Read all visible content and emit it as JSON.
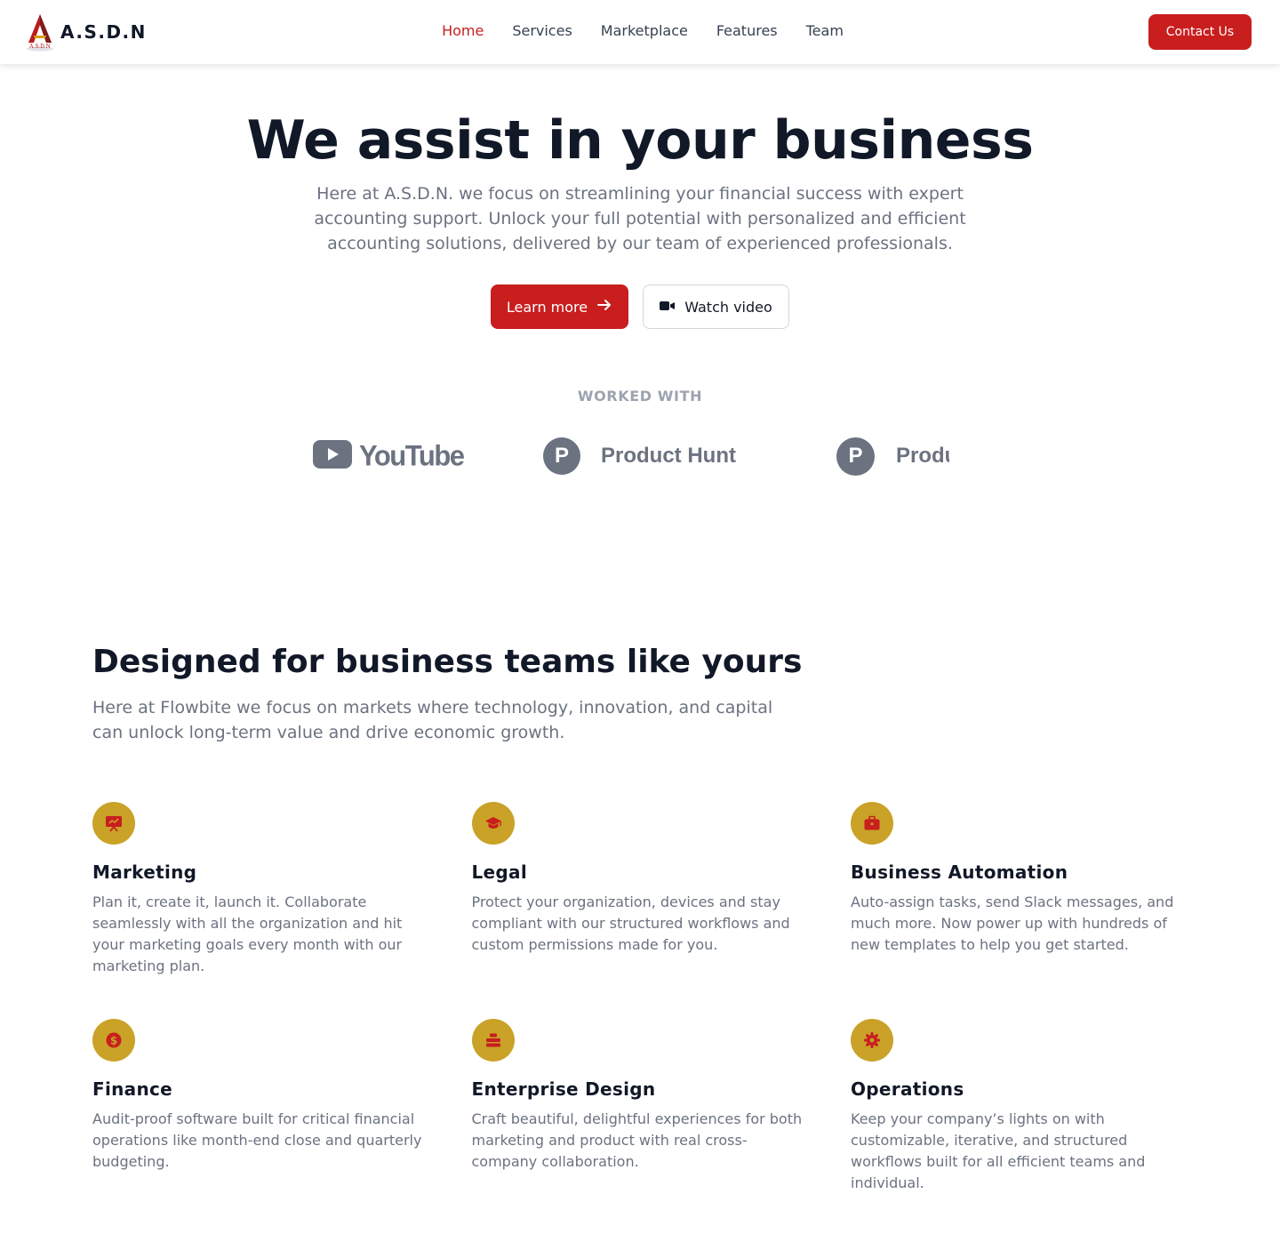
{
  "brand": {
    "name": "A.S.D.N",
    "logo_text": "A.S.D.N"
  },
  "nav": {
    "links": [
      {
        "label": "Home",
        "active": true
      },
      {
        "label": "Services",
        "active": false
      },
      {
        "label": "Marketplace",
        "active": false
      },
      {
        "label": "Features",
        "active": false
      },
      {
        "label": "Team",
        "active": false
      }
    ],
    "cta_label": "Contact Us"
  },
  "hero": {
    "title": "We assist in your business",
    "subtitle": "Here at A.S.D.N. we focus on streamlining your financial success with expert accounting support. Unlock your full potential with personalized and efficient accounting solutions, delivered by our team of experienced professionals.",
    "primary_label": "Learn more",
    "secondary_label": "Watch video"
  },
  "worked_with": {
    "label": "WORKED WITH",
    "logos": [
      {
        "name": "YouTube",
        "text": "YouTube",
        "icon": "youtube-play-icon"
      },
      {
        "name": "Product Hunt",
        "text": "Product Hunt",
        "icon": "product-hunt-icon",
        "letter": "P"
      },
      {
        "name": "Product Hunt",
        "text": "Product Hunt",
        "icon": "product-hunt-icon",
        "letter": "P"
      }
    ]
  },
  "features_section": {
    "title": "Designed for business teams like yours",
    "subtitle": "Here at Flowbite we focus on markets where technology, innovation, and capital can unlock long-term value and drive economic growth.",
    "items": [
      {
        "title": "Marketing",
        "icon": "presentation-chart-icon",
        "description": "Plan it, create it, launch it. Collaborate seamlessly with all the organization and hit your marketing goals every month with our marketing plan."
      },
      {
        "title": "Legal",
        "icon": "graduation-cap-icon",
        "description": "Protect your organization, devices and stay compliant with our structured workflows and custom permissions made for you."
      },
      {
        "title": "Business Automation",
        "icon": "briefcase-icon",
        "description": "Auto-assign tasks, send Slack messages, and much more. Now power up with hundreds of new templates to help you get started."
      },
      {
        "title": "Finance",
        "icon": "dollar-circle-icon",
        "description": "Audit-proof software built for critical financial operations like month-end close and quarterly budgeting."
      },
      {
        "title": "Enterprise Design",
        "icon": "layers-icon",
        "description": "Craft beautiful, delightful experiences for both marketing and product with real cross-company collaboration."
      },
      {
        "title": "Operations",
        "icon": "gear-icon",
        "description": "Keep your company’s lights on with customizable, iterative, and structured workflows built for all efficient teams and individual."
      }
    ]
  },
  "colors": {
    "accent": "#c81e1e",
    "icon_bg": "#c9a227",
    "heading": "#111827",
    "muted": "#6b7280",
    "logo_gray": "#6b7280"
  }
}
